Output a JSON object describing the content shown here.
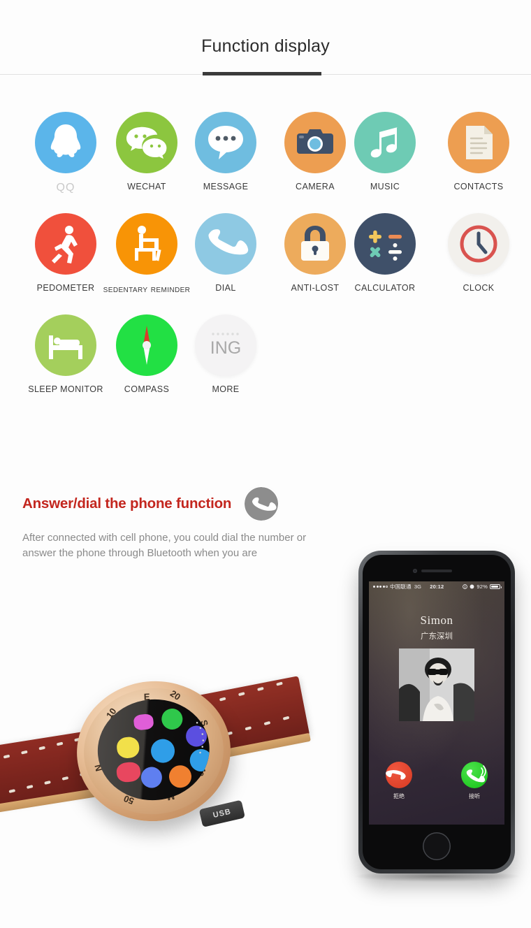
{
  "header": {
    "title": "Function display"
  },
  "features": {
    "rows": [
      [
        {
          "label": "QQ",
          "icon": "qq-icon",
          "bg": "#5bb5ea",
          "style": "muted"
        },
        {
          "label": "WECHAT",
          "icon": "wechat-icon",
          "bg": "#8cc63f"
        },
        {
          "label": "MESSAGE",
          "icon": "message-bubble-icon",
          "bg": "#6fbde0"
        },
        {
          "label": "CAMERA",
          "icon": "camera-icon",
          "bg": "#ed9e51"
        },
        {
          "label": "MUSIC",
          "icon": "music-note-icon",
          "bg": "#6ecbb4"
        },
        {
          "label": "CONTACTS",
          "icon": "document-icon",
          "bg": "#ed9e51"
        }
      ],
      [
        {
          "label": "PEDOMETER",
          "icon": "runner-icon",
          "bg": "#f0503c"
        },
        {
          "label": "Sedentary reminder",
          "icon": "sitting-person-icon",
          "bg": "#f89406",
          "style": "smallcaps"
        },
        {
          "label": "DIAL",
          "icon": "phone-handset-icon",
          "bg": "#8ec9e3"
        },
        {
          "label": "ANTI-LOST",
          "icon": "padlock-icon",
          "bg": "#edab5c"
        },
        {
          "label": "CALCULATOR",
          "icon": "calculator-icon",
          "bg": "#3f5069"
        },
        {
          "label": "CLOCK",
          "icon": "clock-icon",
          "bg": "#f2f0ec"
        }
      ],
      [
        {
          "label": "SLEEP MONITOR",
          "icon": "bed-icon",
          "bg": "#a4cf5c"
        },
        {
          "label": "COMPASS",
          "icon": "compass-needle-icon",
          "bg": "#22e044"
        },
        {
          "label": "MORE",
          "icon": "more-ing-icon",
          "bg": "#f4f3f4"
        }
      ]
    ]
  },
  "promo": {
    "title": "Answer/dial the phone function",
    "badge_icon": "phone-handset-icon",
    "body": "After connected with cell phone, you could dial the number or answer the phone through Bluetooth when you are",
    "title_color": "#c3261e"
  },
  "product": {
    "watch": {
      "name": "smartwatch",
      "port_label": "USB",
      "bezel_marks": [
        "E",
        "10",
        "20",
        "S",
        "40",
        "M",
        "50",
        "N"
      ]
    },
    "phone": {
      "statusbar": {
        "carrier": "中国联通",
        "network": "3G",
        "time": "20:12",
        "battery": "92%"
      },
      "caller_name": "Simon",
      "caller_location": "广东深圳",
      "decline_label": "拒绝",
      "accept_label": "接听",
      "decline_color": "#e0412a",
      "accept_color": "#1ecb1e"
    }
  }
}
